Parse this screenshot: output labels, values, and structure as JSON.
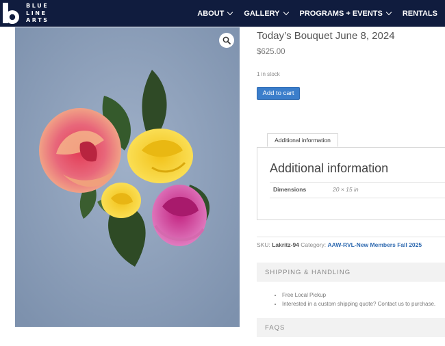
{
  "brand": {
    "logo_letter": "b",
    "logo_lines": [
      "BLUE",
      "LINE",
      "ARTS"
    ]
  },
  "nav": [
    {
      "label": "ABOUT",
      "has_dropdown": true
    },
    {
      "label": "GALLERY",
      "has_dropdown": true
    },
    {
      "label": "PROGRAMS + EVENTS",
      "has_dropdown": true
    },
    {
      "label": "RENTALS",
      "has_dropdown": false
    }
  ],
  "product": {
    "title": "Today’s Bouquet June 8, 2024",
    "price": "$625.00",
    "stock": "1 in stock",
    "add_to_cart": "Add to cart",
    "zoom_icon": "magnifier-icon"
  },
  "tabs": {
    "active_tab": "Additional information",
    "panel_title": "Additional information",
    "attributes": [
      {
        "label": "Dimensions",
        "value": "20 × 15 in"
      }
    ]
  },
  "meta": {
    "sku_label": "SKU:",
    "sku": "Lakritz-94",
    "category_label": "Category:",
    "category": "AAW-RVL-New Members Fall 2025"
  },
  "accordions": {
    "shipping": {
      "title": "SHIPPING & HANDLING",
      "items": [
        "Free Local Pickup",
        "Interested in a custom shipping quote? Contact us to purchase."
      ]
    },
    "faqs": {
      "title": "FAQS"
    }
  },
  "colors": {
    "header_bg": "#101c3e",
    "button_blue": "#3b7ecb",
    "link_blue": "#2f6ab0"
  }
}
